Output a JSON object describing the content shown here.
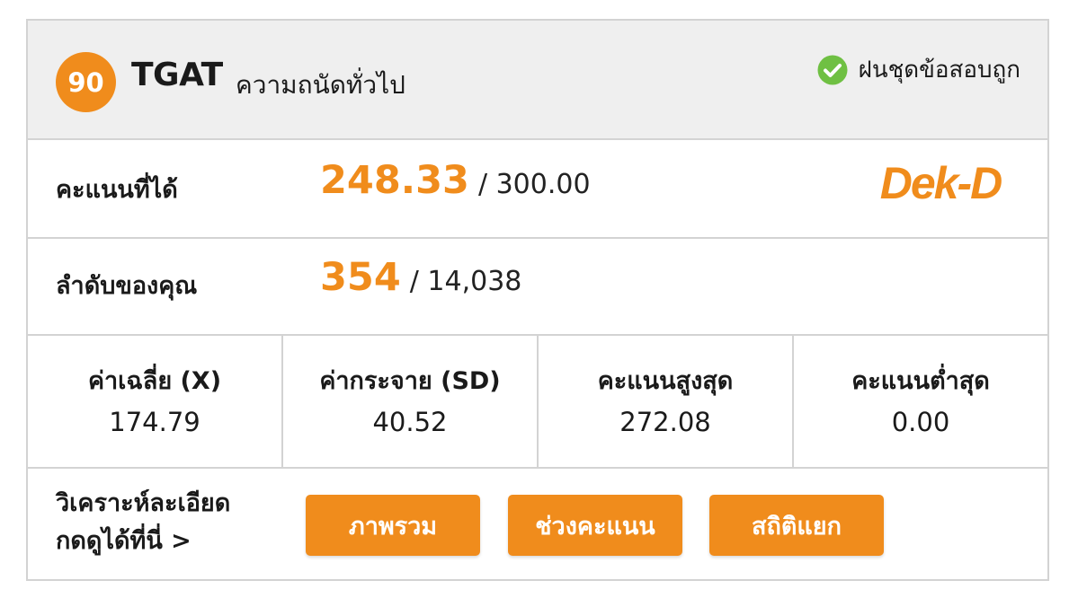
{
  "header": {
    "badge_number": "90",
    "title": "TGAT",
    "subtitle": "ความถนัดทั่วไป",
    "status_text": "ฝนชุดข้อสอบถูก",
    "status_icon": "check-circle-icon",
    "status_color": "#6fc043"
  },
  "score": {
    "label": "คะแนนที่ได้",
    "value": "248.33",
    "total": "/ 300.00"
  },
  "brand": {
    "logo_text": "Dek-D",
    "color": "#f08c1c"
  },
  "rank": {
    "label": "ลำดับของคุณ",
    "value": "354",
    "total": "/ 14,038"
  },
  "stats": [
    {
      "label": "ค่าเฉลี่ย (X)",
      "value": "174.79"
    },
    {
      "label": "ค่ากระจาย (SD)",
      "value": "40.52"
    },
    {
      "label": "คะแนนสูงสุด",
      "value": "272.08"
    },
    {
      "label": "คะแนนต่ำสุด",
      "value": "0.00"
    }
  ],
  "analysis": {
    "line1": "วิเคราะห์ละเอียด",
    "line2": "กดดูได้ที่นี่ >",
    "buttons": [
      "ภาพรวม",
      "ช่วงคะแนน",
      "สถิติแยก"
    ]
  },
  "accent_color": "#f08c1c"
}
